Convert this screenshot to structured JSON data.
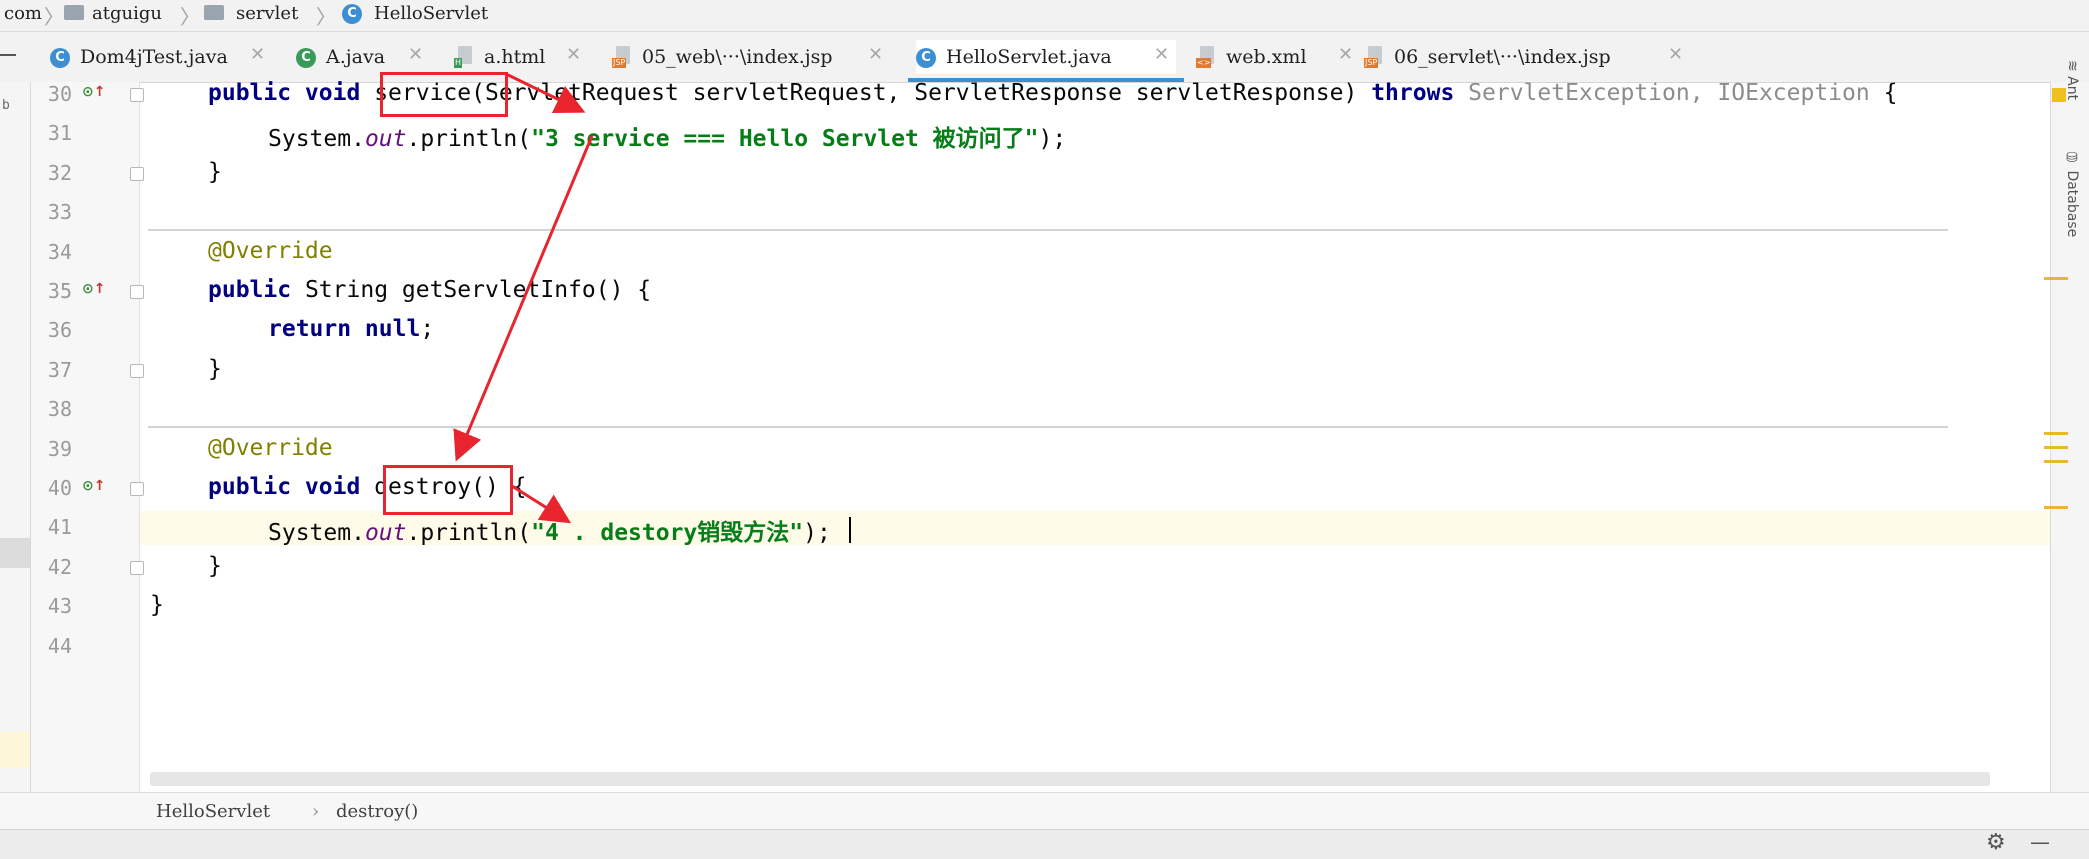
{
  "breadcrumb": [
    "com",
    "atguigu",
    "servlet",
    "HelloServlet"
  ],
  "tabs": [
    {
      "label": "Dom4jTest.java",
      "icon": "class-icon"
    },
    {
      "label": "A.java",
      "icon": "class-icon"
    },
    {
      "label": "a.html",
      "icon": "html-file-icon"
    },
    {
      "label": "05_web\\···\\index.jsp",
      "icon": "jsp-file-icon"
    },
    {
      "label": "HelloServlet.java",
      "icon": "class-icon",
      "active": true
    },
    {
      "label": "web.xml",
      "icon": "xml-file-icon"
    },
    {
      "label": "06_servlet\\···\\index.jsp",
      "icon": "jsp-file-icon"
    }
  ],
  "gutter": {
    "line_numbers": [
      "30",
      "31",
      "32",
      "33",
      "34",
      "35",
      "36",
      "37",
      "38",
      "39",
      "40",
      "41",
      "42",
      "43",
      "44"
    ]
  },
  "code": {
    "l30": {
      "kw1": "public void",
      "name": "service",
      "rest": "(ServletRequest servletRequest, ServletResponse servletResponse)",
      "throws": "throws",
      "exc": "ServletException, IOException",
      "brace": "{"
    },
    "l31": {
      "sys": "System.",
      "out": "out",
      "call": ".println(",
      "str": "\"3 service === Hello Servlet 被访问了\"",
      "end": ");"
    },
    "l32": "}",
    "l34": "@Override",
    "l35": {
      "kw1": "public",
      "rest": "String getServletInfo() {"
    },
    "l36": {
      "kw1": "return null",
      "end": ";"
    },
    "l37": "}",
    "l39": "@Override",
    "l40": {
      "kw1": "public void",
      "name": "destroy",
      "rest": "() {"
    },
    "l41": {
      "sys": "System.",
      "out": "out",
      "call": ".println(",
      "str": "\"4 . destory销毁方法\"",
      "end": ");"
    },
    "l42": "}",
    "l43": "}"
  },
  "status_breadcrumb": [
    "HelloServlet",
    "destroy()"
  ],
  "accent_colors": {
    "annotation_red": "#e8242e",
    "active_tab": "#3c8fd3"
  }
}
